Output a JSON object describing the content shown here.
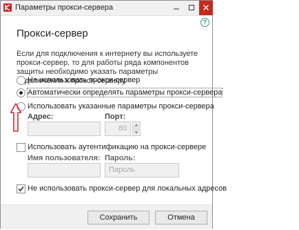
{
  "window": {
    "title": "Параметры прокси-сервера"
  },
  "help": {
    "glyph": "?"
  },
  "main": {
    "heading": "Прокси-сервер",
    "description": "Если для подключения к интернету вы используете прокси-сервер, то для работы ряда компонентов защиты необходимо указать параметры подключения к прокси-серверу."
  },
  "options": {
    "no_proxy": "Не использовать прокси-сервер",
    "auto_detect": "Автоматически определять параметры прокси-сервера",
    "manual": "Использовать указанные параметры прокси-сервера",
    "selected": "auto_detect"
  },
  "address": {
    "label": "Адрес:",
    "value": ""
  },
  "port": {
    "label": "Порт:",
    "value": "80"
  },
  "auth": {
    "label": "Использовать аутентификацию на прокси-сервере",
    "checked": false
  },
  "username": {
    "label": "Имя пользователя:",
    "value": ""
  },
  "password": {
    "label": "Пароль:",
    "placeholder": "Пароль"
  },
  "bypass_local": {
    "label": "Не использовать прокси-сервер для локальных адресов",
    "checked": true
  },
  "buttons": {
    "save": "Сохранить",
    "cancel": "Отмена"
  },
  "colors": {
    "accent_red": "#d41d24",
    "help_green": "#2e9b6f",
    "close_red": "#c42b1c",
    "arrow_red": "#d2282d"
  }
}
